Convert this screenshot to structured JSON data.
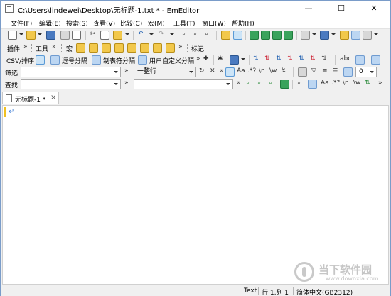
{
  "window": {
    "title": "C:\\Users\\lindewei\\Desktop\\无标题-1.txt * - EmEditor",
    "minimize": "—",
    "maximize": "☐",
    "close": "✕"
  },
  "menu": [
    "文件(F)",
    "编辑(E)",
    "搜索(S)",
    "查看(V)",
    "比较(C)",
    "宏(M)",
    "工具(T)",
    "窗口(W)",
    "帮助(H)"
  ],
  "toolbar2": {
    "plugins": "插件",
    "tools": "工具",
    "macro": "宏",
    "marker": "标记"
  },
  "toolbar3": {
    "csv_sort": "CSV/排序",
    "comma": "逗号分隔",
    "tab": "制表符分隔",
    "custom": "用户自定义分隔"
  },
  "filter_bar": {
    "label": "筛选",
    "value": "",
    "scope": "一整行"
  },
  "find_bar": {
    "label": "查找",
    "value": "",
    "replace_value": ""
  },
  "filter_tools": {
    "regex": "\\n",
    "case": "Aa",
    "wildcard": ".*?",
    "whole_word": "\\w",
    "number": "0"
  },
  "document_tab": {
    "label": "无标题-1 *"
  },
  "editor": {
    "newline_mark": "↵"
  },
  "status": {
    "mode": "Text",
    "position": "行 1,列 1",
    "encoding": "简体中文(GB2312)"
  },
  "watermark": {
    "name": "当下软件园",
    "url": "www.downxia.com"
  }
}
